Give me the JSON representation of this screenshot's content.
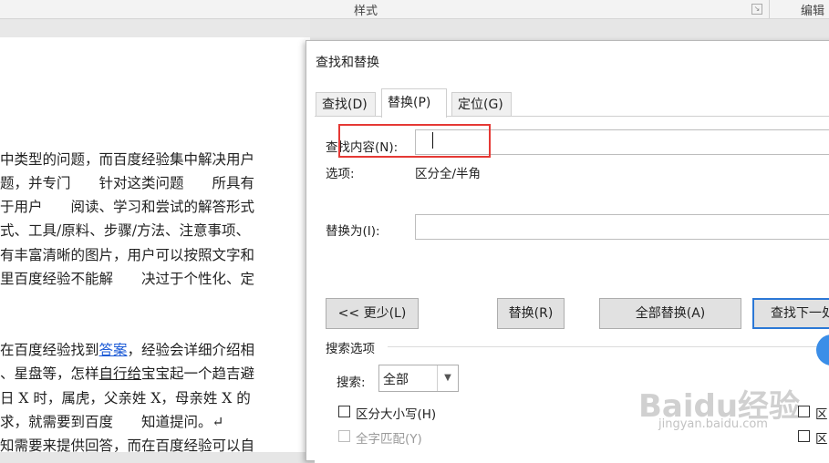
{
  "ribbon": {
    "styles_label": "样式",
    "edit_label": "编辑"
  },
  "document": {
    "lines": [
      "中类型的问题，而百度经验集中解决用户",
      "题，并专门　　针对这类问题　　所具有",
      "于用户　　阅读、学习和尝试的解答形式",
      "式、工具/原料、步骤/方法、注意事项、",
      "有丰富清晰的图片，用户可以按照文字和",
      "里百度经验不能解　　决过于个性化、定",
      "在百度经验找到",
      "答案",
      "，经验会详细介绍相",
      "、星盘等，怎样",
      "自行给",
      "宝宝起一个趋吉避",
      "日 X 时，属虎，父亲姓 X，母亲姓 X 的",
      "求，就需要到百度　　知道提问。↵",
      "知需要来提供回答，而在百度经验可以自"
    ]
  },
  "dialog": {
    "title": "查找和替换",
    "tabs": [
      "查找(D)",
      "替换(P)",
      "定位(G)"
    ],
    "find_label": "查找内容(N):",
    "find_value": "",
    "options_label": "选项:",
    "options_value": "区分全/半角",
    "replace_label": "替换为(I):",
    "replace_value": "",
    "buttons": {
      "less": "<< 更少(L)",
      "replace": "替换(R)",
      "replace_all": "全部替换(A)",
      "find_next": "查找下一处"
    },
    "search_options_label": "搜索选项",
    "search_label": "搜索:",
    "search_value": "全部",
    "match_case": "区分大小写(H)",
    "whole_word": "全字匹配(Y)",
    "right_checkbox_1": "区",
    "right_checkbox_2": "区"
  },
  "watermark": {
    "main": "Baidu经验",
    "sub": "jingyan.baidu.com"
  }
}
